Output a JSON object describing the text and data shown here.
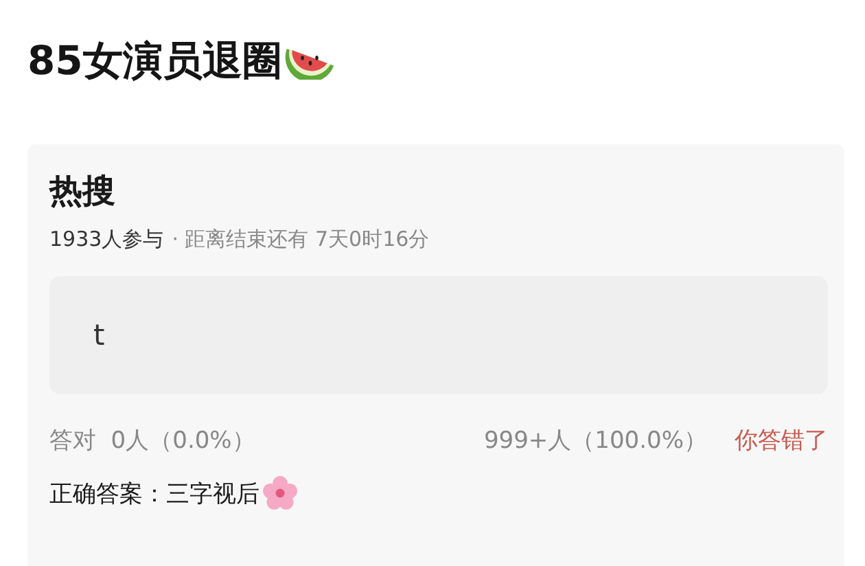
{
  "title": "85女演员退圈",
  "card": {
    "heading": "热搜",
    "participants": "1933人参与",
    "countdown": "· 距离结束还有 7天0时16分",
    "answer": {
      "value": "t"
    },
    "stats": [
      {
        "label": "答对",
        "count": "0人（0.0%）"
      },
      {
        "count": "999+人（100.0%）"
      }
    ],
    "result": "你答错了",
    "correct_label": "正确答案：",
    "correct_value": "三字视后"
  }
}
